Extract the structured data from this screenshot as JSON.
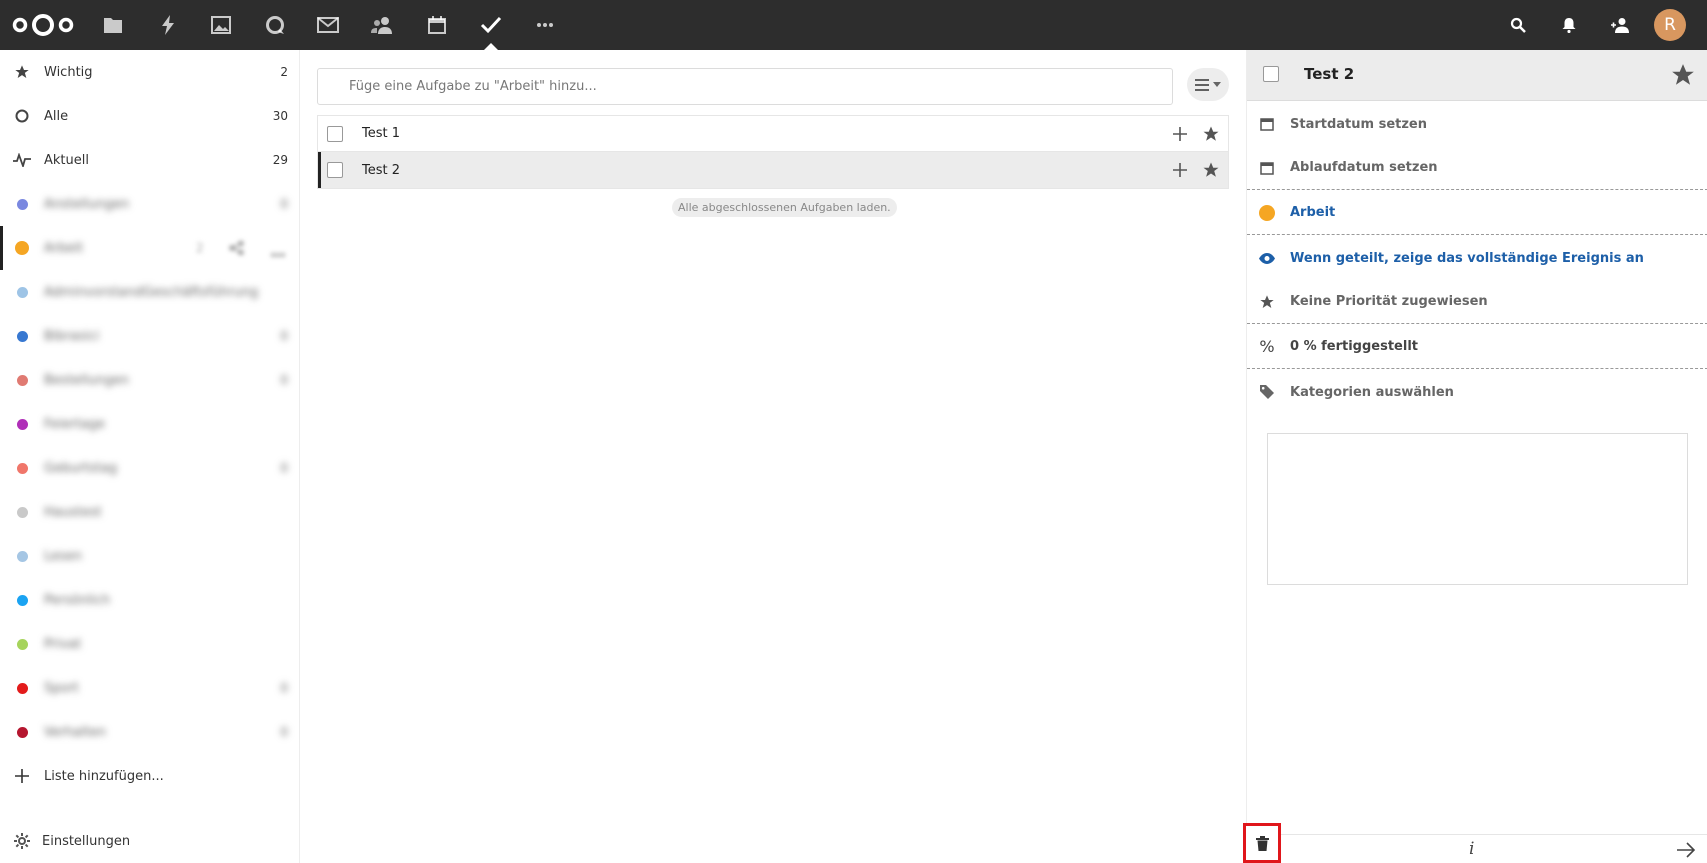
{
  "header": {
    "apps": [
      "files-icon",
      "activity-icon",
      "photos-icon",
      "talk-icon",
      "mail-icon",
      "contacts-icon",
      "calendar-icon",
      "tasks-icon",
      "more-apps-icon"
    ],
    "avatar_initial": "R",
    "colors": {
      "bar": "#2d2d2d",
      "avatar": "#d8975f"
    }
  },
  "sidebar": {
    "items": [
      {
        "label": "Wichtig",
        "count": "2",
        "icon": "star-icon"
      },
      {
        "label": "Alle",
        "count": "30",
        "icon": "circle-icon"
      },
      {
        "label": "Aktuell",
        "count": "29",
        "icon": "pulse-icon"
      },
      {
        "label": "Anstellungen",
        "count": "0",
        "color": "#7a88e0"
      },
      {
        "label": "Arbeit",
        "count": "2",
        "color": "#f5a623"
      },
      {
        "label": "AdminvorstandGeschäftsführung",
        "count": "",
        "color": "#9ec4e6"
      },
      {
        "label": "Bibrasici",
        "count": "0",
        "color": "#3778d1"
      },
      {
        "label": "Bestellungen",
        "count": "0",
        "color": "#e07a72"
      },
      {
        "label": "Feiertage",
        "count": "",
        "color": "#b02fb8"
      },
      {
        "label": "Geburtstag",
        "count": "0",
        "color": "#f0766a"
      },
      {
        "label": "Haustest",
        "count": "",
        "color": "#c9c9c9"
      },
      {
        "label": "Lesen",
        "count": "",
        "color": "#a5c6e4"
      },
      {
        "label": "Persönlich",
        "count": "",
        "color": "#1aa3f2"
      },
      {
        "label": "Privat",
        "count": "",
        "color": "#a6d45c"
      },
      {
        "label": "Sport",
        "count": "0",
        "color": "#e31b1b"
      },
      {
        "label": "Verhalten",
        "count": "0",
        "color": "#b5162f"
      }
    ],
    "add_list_label": "Liste hinzufügen...",
    "settings_label": "Einstellungen"
  },
  "main": {
    "add_placeholder": "Füge eine Aufgabe zu \"Arbeit\" hinzu...",
    "tasks": [
      {
        "title": "Test 1"
      },
      {
        "title": "Test 2"
      }
    ],
    "load_completed_label": "Alle abgeschlossenen Aufgaben laden."
  },
  "details": {
    "title": "Test 2",
    "start_date_label": "Startdatum setzen",
    "due_date_label": "Ablaufdatum setzen",
    "calendar_label": "Arbeit",
    "calendar_color": "#f5a623",
    "visibility_label": "Wenn geteilt, zeige das vollständige Ereignis an",
    "priority_label": "Keine Priorität zugewiesen",
    "progress_label": "0 % fertiggestellt",
    "progress_percent": 0,
    "categories_label": "Kategorien auswählen",
    "info_label": "i",
    "highlight_color": "#e0161b"
  }
}
